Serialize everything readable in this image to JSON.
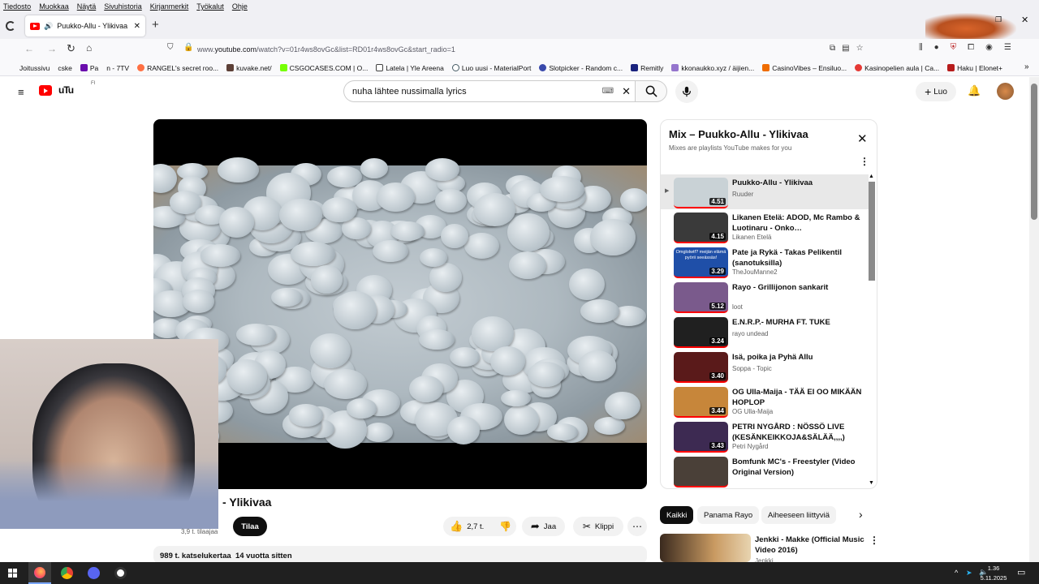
{
  "menubar": [
    "Tiedosto",
    "Muokkaa",
    "Näytä",
    "Sivuhistoria",
    "Kirjanmerkit",
    "Työkalut",
    "Ohje"
  ],
  "tab": {
    "title": "Puukko-Allu - Ylikivaa",
    "close": "✕",
    "new": "+"
  },
  "url": {
    "prefix": "www.",
    "domain": "youtube.com",
    "path": "/watch?v=01r4ws8ovGc&list=RD01r4ws8ovGc&start_radio=1"
  },
  "bookmarks": [
    {
      "label": "Joitussivu",
      "color": "#888888"
    },
    {
      "label": "cske",
      "color": "#333333"
    },
    {
      "label": "Pa",
      "color": "#6a0dad"
    },
    {
      "label": "n - 7TV",
      "color": "#29b6f6"
    },
    {
      "label": "RANGEL's secret roo...",
      "color": "#ff7043"
    },
    {
      "label": "kuvake.net/",
      "color": "#5d4037"
    },
    {
      "label": "CSGOCASES.COM | O...",
      "color": "#76ff03"
    },
    {
      "label": "Latela | Yle Areena",
      "color": "#424242"
    },
    {
      "label": "Luo uusi - MaterialPort",
      "color": "#455a64"
    },
    {
      "label": "Slotpicker - Random c...",
      "color": "#3949ab"
    },
    {
      "label": "Remitly",
      "color": "#1a237e"
    },
    {
      "label": "kkonaukko.xyz / äijien...",
      "color": "#9575cd"
    },
    {
      "label": "CasinoVibes – Ensiluo...",
      "color": "#ef6c00"
    },
    {
      "label": "Kasinopelien aula | Ca...",
      "color": "#e53935"
    },
    {
      "label": "Haku | Elonet+",
      "color": "#b71c1c"
    }
  ],
  "youtube": {
    "logo_text": "uTu",
    "region": "FI",
    "search_value": "nuha lähtee nussimalla lyrics",
    "create_label": "Luo"
  },
  "video": {
    "title_visible": "Ylikivaa",
    "subscribers": "3,9 t. tilaajaa",
    "subscribe_label": "Tilaa",
    "likes": "2,7 t.",
    "share_label": "Jaa",
    "clip_label": "Klippi",
    "views": "989 t. katselukertaa",
    "age": "14 vuotta sitten"
  },
  "playlist": {
    "title": "Mix – Puukko-Allu - Ylikivaa",
    "subtitle": "Mixes are playlists YouTube makes for you",
    "items": [
      {
        "title": "Puukko-Allu - Ylikivaa",
        "channel": "Ruuder",
        "duration": "4.51",
        "thumb": "#c9d2d6"
      },
      {
        "title": "Likanen Etelä: ADOD, Mc Rambo & Luotinaru - Onko…",
        "channel": "Likanen Etelä",
        "duration": "4.15",
        "thumb": "#3a3a3a"
      },
      {
        "title": "Pate ja Rykä - Takas Pelikentil (sanotuksilla)",
        "channel": "TheJouManne2",
        "duration": "3.29",
        "thumb": "#1f4fa8",
        "overlay": "Omglolwtf? meijän elämä pyörii seeässäs!"
      },
      {
        "title": "Rayo - Grillijonon sankarit",
        "channel": "loot",
        "duration": "5.12",
        "thumb": "#7a5a8c"
      },
      {
        "title": "E.N.R.P.- MURHA FT. TUKE",
        "channel": "rayo undead",
        "duration": "3.24",
        "thumb": "#202020"
      },
      {
        "title": "Isä, poika ja Pyhä Allu",
        "channel": "Soppa - Topic",
        "duration": "3.40",
        "thumb": "#5a1a1a"
      },
      {
        "title": "OG Ulla-Maija - TÄÄ EI OO MIKÄÄN HOPLOP",
        "channel": "OG Ulla-Maija",
        "duration": "3.44",
        "thumb": "#c7863a"
      },
      {
        "title": "PETRI NYGÅRD : NÖSSÖ LIVE (KESÄNKEIKKOJA&SÄLÄÄ,,,,)",
        "channel": "Petri Nygård",
        "duration": "3.43",
        "thumb": "#3d2a52"
      },
      {
        "title": "Bomfunk MC's - Freestyler (Video Original Version)",
        "channel": "",
        "duration": "",
        "thumb": "#4a4038"
      }
    ]
  },
  "chips": [
    "Kaikki",
    "Panama Rayo",
    "Aiheeseen liittyviä"
  ],
  "recommendation": {
    "title": "Jenkki - Makke (Official Music Video 2016)",
    "channel": "Jenkki"
  },
  "taskbar": {
    "time": "1.36",
    "date": "5.11.2025"
  }
}
